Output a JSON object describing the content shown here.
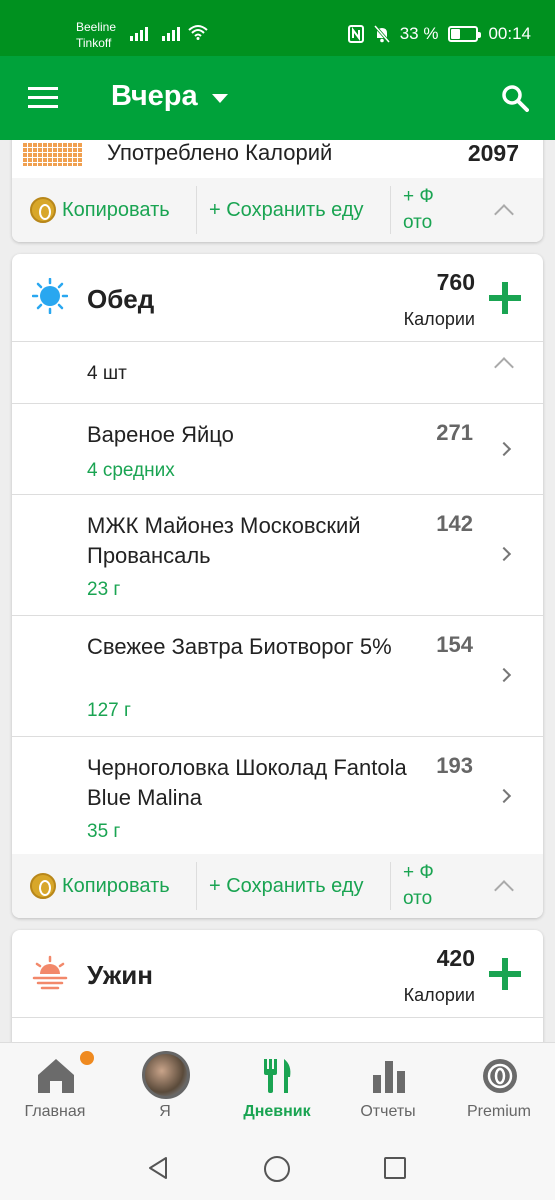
{
  "status_bar": {
    "carrier_1": "Beeline",
    "carrier_2": "Tinkoff",
    "battery_text": "33 %",
    "battery_level_pct": 33,
    "time": "00:14"
  },
  "app_bar": {
    "title": "Вчера",
    "menu_icon": "menu-icon",
    "search_icon": "search-icon"
  },
  "summary": {
    "label": "Употреблено Калорий",
    "value": "2097"
  },
  "actions": {
    "copy": "Копировать",
    "save": "+ Сохранить еду",
    "photo_line1": "+ Ф",
    "photo_line2": "ото"
  },
  "lunch": {
    "title": "Обед",
    "calories": "760",
    "calories_label": "Калории",
    "count": "4 шт",
    "items": [
      {
        "name": "Вареное Яйцо",
        "qty": "4 средних",
        "cal": "271"
      },
      {
        "name": "МЖК Майонез Московский Провансаль",
        "qty": "23 г",
        "cal": "142"
      },
      {
        "name": "Свежее Завтра Биотворог 5%",
        "qty": "127 г",
        "cal": "154"
      },
      {
        "name": "Черноголовка Шоколад Fantola Blue Malina",
        "qty": "35 г",
        "cal": "193"
      }
    ]
  },
  "dinner": {
    "title": "Ужин",
    "calories": "420",
    "calories_label": "Калории"
  },
  "bottom_nav": {
    "home": "Главная",
    "me": "Я",
    "diary": "Дневник",
    "reports": "Отчеты",
    "premium": "Premium"
  },
  "colors": {
    "status_bar": "#00911f",
    "app_bar": "#00a23a",
    "accent_green": "#1aa452"
  }
}
